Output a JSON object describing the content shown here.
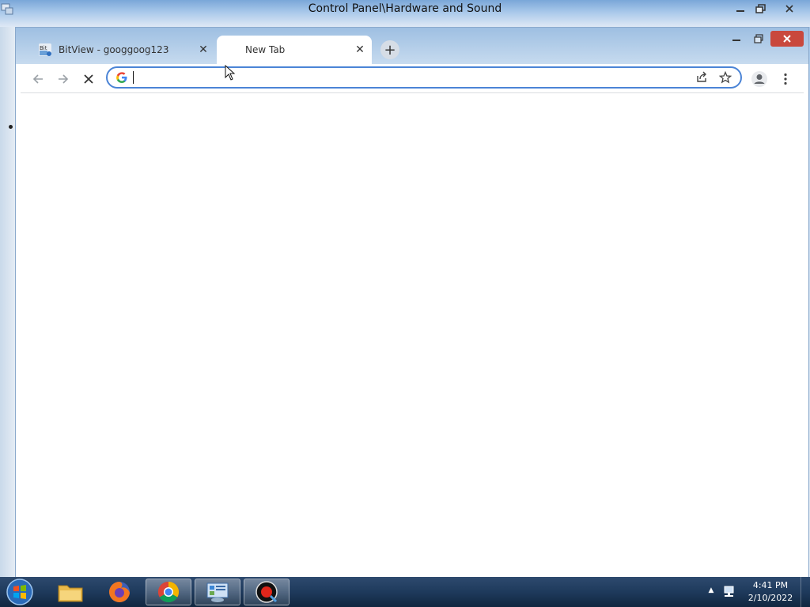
{
  "background_window": {
    "title": "Control Panel\\Hardware and Sound"
  },
  "browser": {
    "tabs": [
      {
        "label": "BitView - googgoog123",
        "favicon_text": "Bit",
        "active": false
      },
      {
        "label": "New Tab",
        "active": true
      }
    ],
    "omnibox": {
      "value": "",
      "placeholder": ""
    },
    "icons": {
      "back": "back-arrow-icon",
      "forward": "forward-arrow-icon",
      "stop": "stop-loading-icon",
      "share": "share-icon",
      "bookmark": "star-icon",
      "profile": "profile-icon",
      "menu": "kebab-menu-icon"
    }
  },
  "taskbar": {
    "items": [
      "file-explorer-icon",
      "firefox-icon",
      "chrome-icon",
      "control-panel-icon",
      "recorder-icon"
    ],
    "active_item": "chrome-icon",
    "clock": {
      "time": "4:41 PM",
      "date": "2/10/2022"
    }
  },
  "colors": {
    "omnibox_focus": "#4b84d6",
    "taskbar": "#1e3a5c"
  }
}
